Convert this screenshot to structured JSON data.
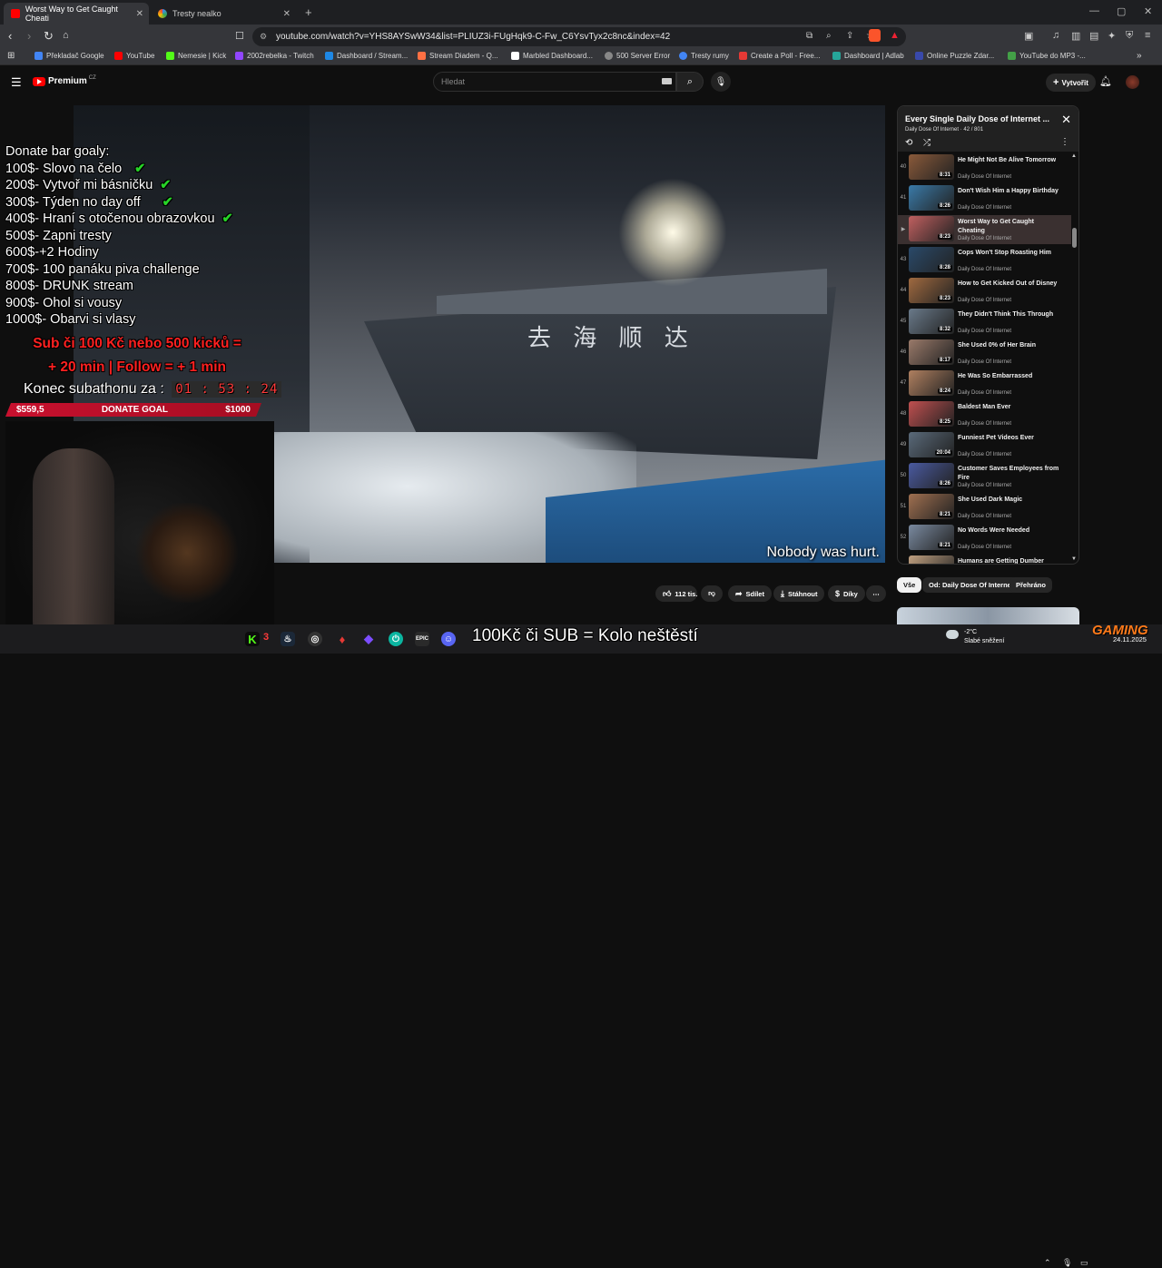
{
  "browser": {
    "tabs": [
      {
        "label": "Worst Way to Get Caught Cheati",
        "active": true,
        "color": "#ff0000"
      },
      {
        "label": "Tresty nealko",
        "active": false,
        "color": "#4285f4"
      }
    ],
    "url": "youtube.com/watch?v=YHS8AYSwW34&list=PLIUZ3i-FUgHqk9-C-Fw_C6YsvTyx2c8nc&index=42",
    "bookmarks": [
      {
        "label": "Překladač Google",
        "color": "#4285f4"
      },
      {
        "label": "YouTube",
        "color": "#ff0000"
      },
      {
        "label": "Nemesie | Kick",
        "color": "#53fc18"
      },
      {
        "label": "2002rebelka - Twitch",
        "color": "#9146ff"
      },
      {
        "label": "Dashboard / Stream...",
        "color": "#1e88e5"
      },
      {
        "label": "Stream Diadem - Q...",
        "color": "#ff7043"
      },
      {
        "label": "Marbled Dashboard...",
        "color": "#ffffff"
      },
      {
        "label": "500 Server Error",
        "color": "#888888"
      },
      {
        "label": "Tresty rumy",
        "color": "#4285f4"
      },
      {
        "label": "Create a Poll - Free...",
        "color": "#e53935"
      },
      {
        "label": "Dashboard | Adlab",
        "color": "#26a69a"
      },
      {
        "label": "Online Puzzle Zdar...",
        "color": "#3949ab"
      },
      {
        "label": "YouTube do MP3 -...",
        "color": "#43a047"
      }
    ]
  },
  "youtube": {
    "logo_text": "Premium",
    "country_code": "CZ",
    "search_placeholder": "Hledat",
    "create_label": "Vytvořit",
    "subtitle": "Nobody was hurt.",
    "hull_text": "去 海 顺 达",
    "actions": {
      "likes": "112 tis.",
      "share": "Sdílet",
      "download": "Stáhnout",
      "thanks": "Díky"
    },
    "chips": [
      "Vše",
      "Od: Daily Dose Of Internet",
      "Přehráno"
    ]
  },
  "playlist": {
    "title": "Every Single Daily Dose of Internet ...",
    "subtitle": "Daily Dose Of Internet · 42 / 801",
    "items": [
      {
        "num": "40",
        "title": "He Might Not Be Alive Tomorrow",
        "channel": "Daily Dose Of Internet",
        "duration": "8:31",
        "color": "#8a5a3a"
      },
      {
        "num": "41",
        "title": "Don't Wish Him a Happy Birthday",
        "channel": "Daily Dose Of Internet",
        "duration": "8:26",
        "color": "#3a7aa8"
      },
      {
        "num": "▶",
        "title": "Worst Way to Get Caught Cheating",
        "channel": "Daily Dose Of Internet",
        "duration": "8:23",
        "color": "#c06060",
        "active": true
      },
      {
        "num": "43",
        "title": "Cops Won't Stop Roasting Him",
        "channel": "Daily Dose Of Internet",
        "duration": "8:28",
        "color": "#2a4a6a"
      },
      {
        "num": "44",
        "title": "How to Get Kicked Out of Disney",
        "channel": "Daily Dose Of Internet",
        "duration": "8:23",
        "color": "#a06a40"
      },
      {
        "num": "45",
        "title": "They Didn't Think This Through",
        "channel": "Daily Dose Of Internet",
        "duration": "8:32",
        "color": "#6a7a8a"
      },
      {
        "num": "46",
        "title": "She Used 0% of Her Brain",
        "channel": "Daily Dose Of Internet",
        "duration": "8:17",
        "color": "#9a7a6a"
      },
      {
        "num": "47",
        "title": "He Was So Embarrassed",
        "channel": "Daily Dose Of Internet",
        "duration": "8:24",
        "color": "#b08060"
      },
      {
        "num": "48",
        "title": "Baldest Man Ever",
        "channel": "Daily Dose Of Internet",
        "duration": "8:25",
        "color": "#c05050"
      },
      {
        "num": "49",
        "title": "Funniest Pet Videos Ever",
        "channel": "Daily Dose Of Internet",
        "duration": "20:04",
        "color": "#5a6a7a"
      },
      {
        "num": "50",
        "title": "Customer Saves Employees from Fire",
        "channel": "Daily Dose Of Internet",
        "duration": "8:26",
        "color": "#4a5aa0"
      },
      {
        "num": "51",
        "title": "She Used Dark Magic",
        "channel": "Daily Dose Of Internet",
        "duration": "8:21",
        "color": "#a07050"
      },
      {
        "num": "52",
        "title": "No Words Were Needed",
        "channel": "Daily Dose Of Internet",
        "duration": "8:21",
        "color": "#7a8aa0"
      },
      {
        "num": "53",
        "title": "Humans are Getting Dumber",
        "channel": "Daily Dose Of Internet",
        "duration": "",
        "color": "#c0a080"
      }
    ]
  },
  "overlay": {
    "goals_title": "Donate bar goaly:",
    "goals": [
      {
        "text": "100$- Slovo na čelo",
        "done": true
      },
      {
        "text": "200$- Vytvoř mi básničku",
        "done": true
      },
      {
        "text": "300$- Týden no day off",
        "done": true
      },
      {
        "text": "400$- Hraní s otočenou obrazovkou",
        "done": true
      },
      {
        "text": "500$-  Zapni tresty",
        "done": false
      },
      {
        "text": "600$-+2 Hodiny",
        "done": false
      },
      {
        "text": "700$- 100 panáku piva challenge",
        "done": false
      },
      {
        "text": "800$-  DRUNK stream",
        "done": false
      },
      {
        "text": "900$- Ohol si vousy",
        "done": false
      },
      {
        "text": "1000$- Obarvi si vlasy",
        "done": false
      }
    ],
    "subs_line1": "Sub či 100 Kč nebo 500 kicků =",
    "subs_line2": "+ 20 min | Follow = + 1 min",
    "subathon_label": "Konec subathonu za :",
    "timer": "01 : 53 : 24",
    "donate_current": "$559,5",
    "donate_label": "DONATE GOAL",
    "donate_target": "$1000",
    "donate_progress": 0.5595,
    "kolo_text": "100Kč či SUB = Kolo neštěstí"
  },
  "taskbar": {
    "kick_count": "3",
    "weather_temp": "-2°C",
    "weather_desc": "Slabé sněžení",
    "date": "24.11.2025",
    "gaming_label": "GAMING"
  }
}
